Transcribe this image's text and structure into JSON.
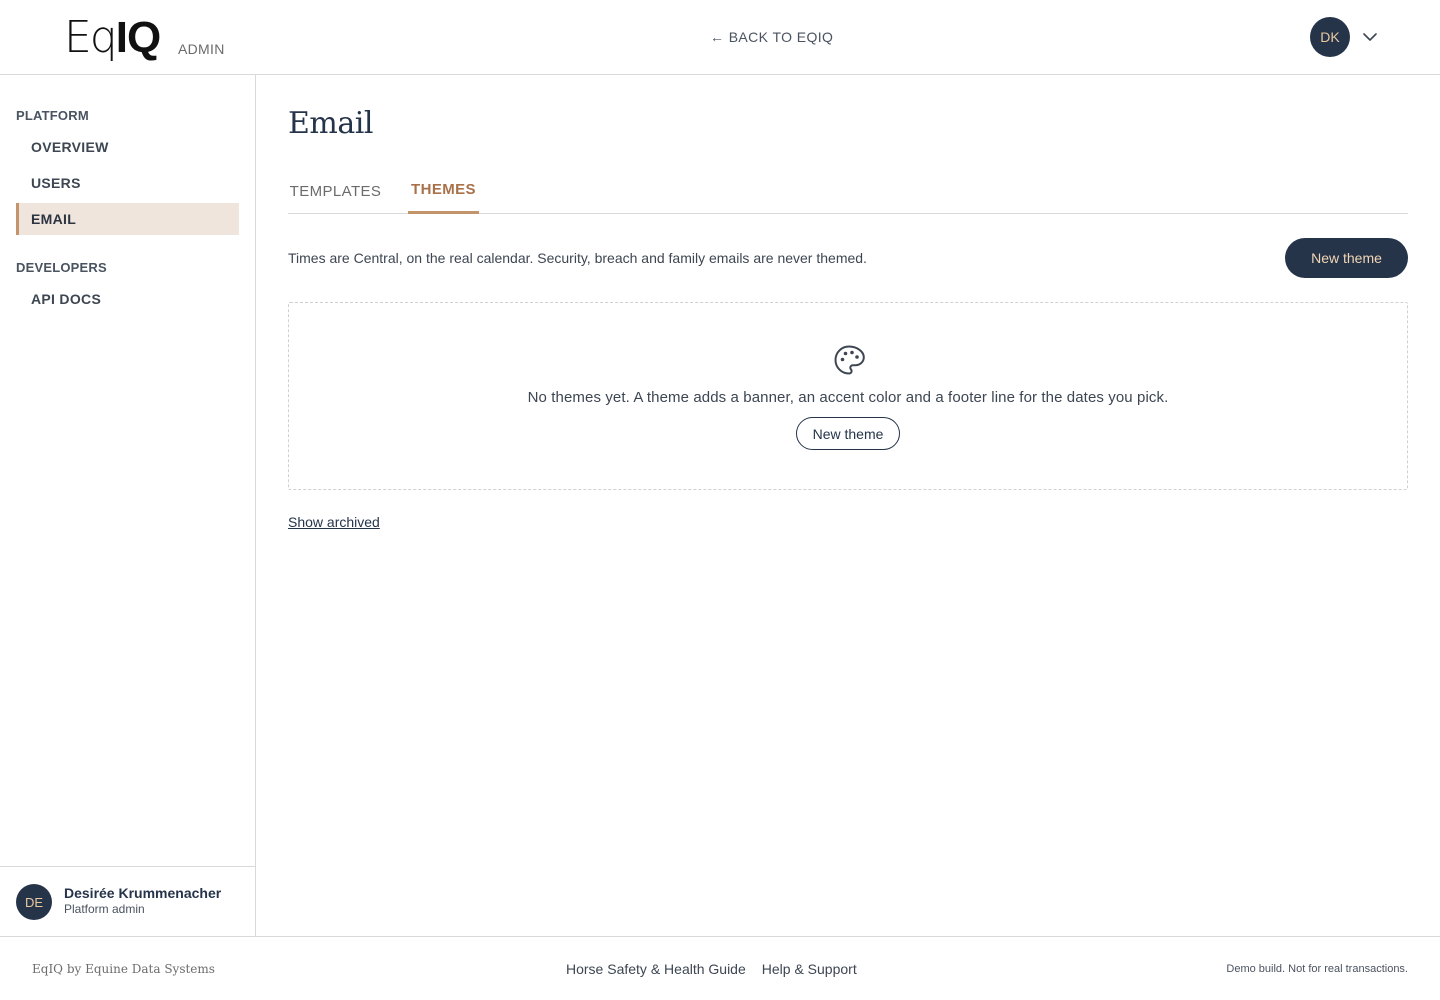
{
  "header": {
    "logo_eq": "Eq",
    "logo_iq": "IQ",
    "logo_suffix": "ADMIN",
    "back_link": "← BACK TO EQIQ",
    "user_initials": "DK"
  },
  "sidebar": {
    "sections": [
      {
        "title": "PLATFORM",
        "items": [
          {
            "label": "OVERVIEW",
            "active": false
          },
          {
            "label": "USERS",
            "active": false
          },
          {
            "label": "EMAIL",
            "active": true
          }
        ]
      },
      {
        "title": "DEVELOPERS",
        "items": [
          {
            "label": "API DOCS",
            "active": false
          }
        ]
      }
    ],
    "user": {
      "initials": "DE",
      "name": "Desirée Krummenacher",
      "role": "Platform admin"
    }
  },
  "main": {
    "title": "Email",
    "tabs": [
      {
        "label": "TEMPLATES",
        "active": false
      },
      {
        "label": "THEMES",
        "active": true
      }
    ],
    "info_text": "Times are Central, on the real calendar. Security, breach and family emails are never themed.",
    "new_theme_button": "New theme",
    "empty_state": {
      "icon": "palette-icon",
      "message": "No themes yet. A theme adds a banner, an accent color and a footer line for the dates you pick.",
      "button": "New theme"
    },
    "show_archived": "Show archived"
  },
  "footer": {
    "brand": "EqIQ by Equine Data Systems",
    "links": [
      "Horse Safety & Health Guide",
      "Help & Support"
    ],
    "note": "Demo build. Not for real transactions."
  },
  "colors": {
    "navy": "#26344a",
    "accent": "#c4946a",
    "active_bg": "#efe5dd"
  }
}
